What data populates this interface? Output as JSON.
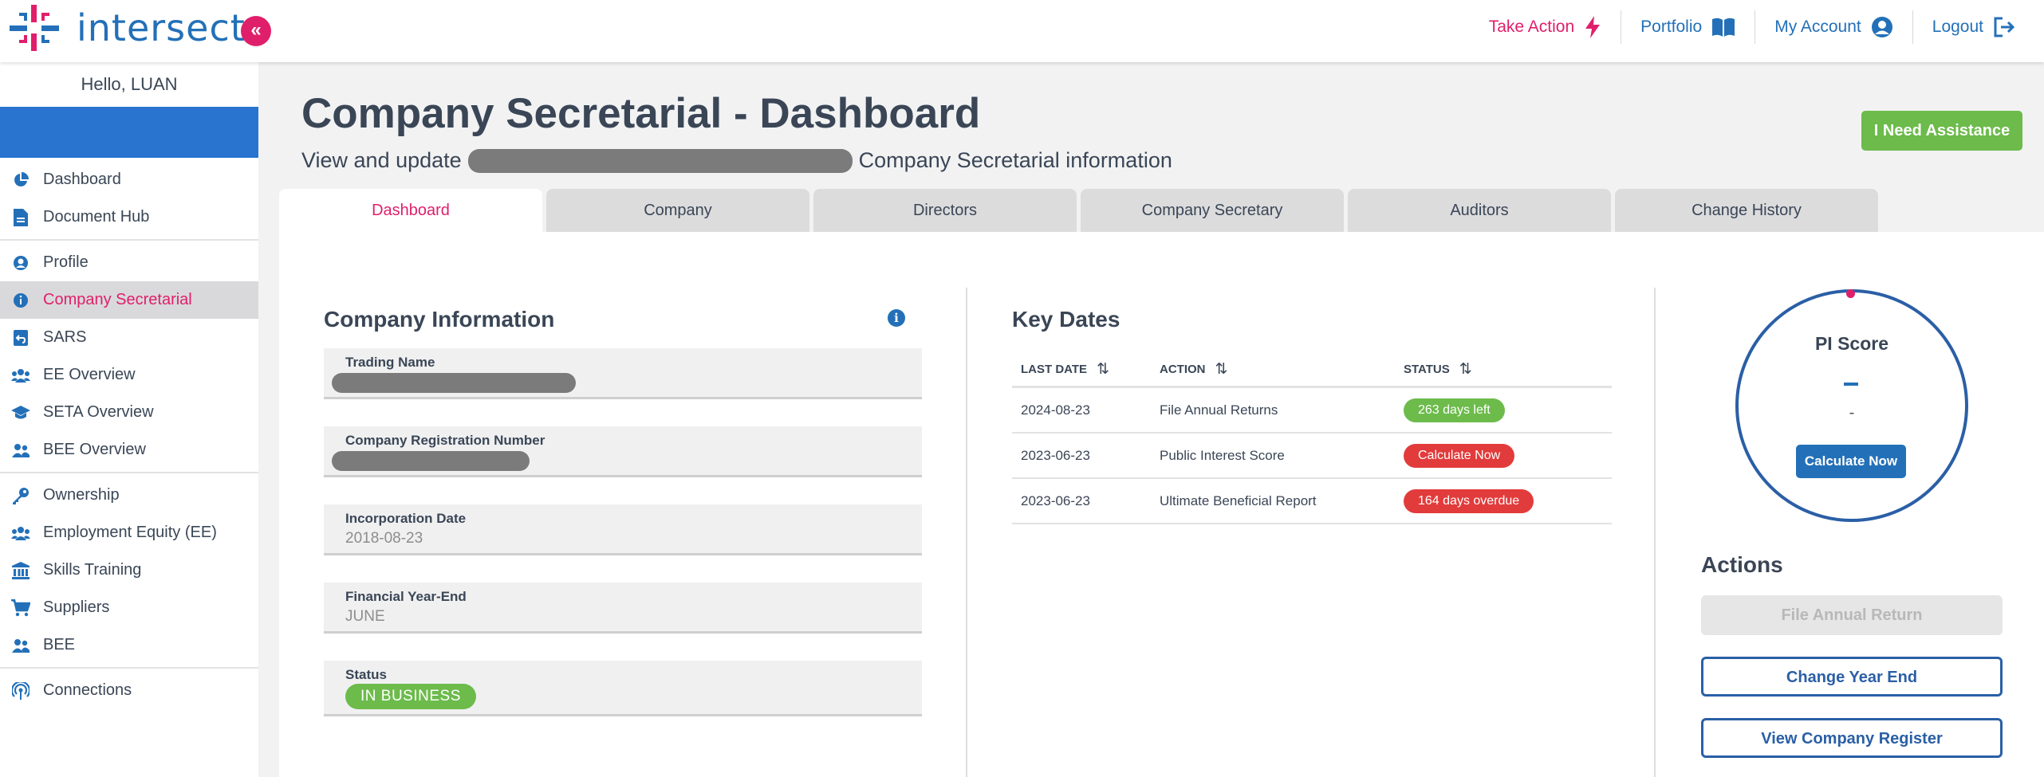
{
  "header": {
    "brand": "intersect",
    "nav": [
      {
        "label": "Take Action",
        "icon": "lightning-icon"
      },
      {
        "label": "Portfolio",
        "icon": "book-icon"
      },
      {
        "label": "My Account",
        "icon": "user-circle-icon"
      },
      {
        "label": "Logout",
        "icon": "logout-icon"
      }
    ]
  },
  "sidebar": {
    "greeting": "Hello, LUAN",
    "groups": [
      [
        {
          "label": "Dashboard",
          "icon": "pie-chart-icon"
        },
        {
          "label": "Document Hub",
          "icon": "document-icon"
        }
      ],
      [
        {
          "label": "Profile",
          "icon": "user-circle-icon"
        },
        {
          "label": "Company Secretarial",
          "icon": "info-icon",
          "active": true
        },
        {
          "label": "SARS",
          "icon": "return-icon"
        },
        {
          "label": "EE Overview",
          "icon": "users-icon"
        },
        {
          "label": "SETA Overview",
          "icon": "graduation-cap-icon"
        },
        {
          "label": "BEE Overview",
          "icon": "people-icon"
        }
      ],
      [
        {
          "label": "Ownership",
          "icon": "key-icon"
        },
        {
          "label": "Employment Equity (EE)",
          "icon": "users-icon"
        },
        {
          "label": "Skills Training",
          "icon": "bank-icon"
        },
        {
          "label": "Suppliers",
          "icon": "cart-icon"
        },
        {
          "label": "BEE",
          "icon": "people-icon"
        }
      ],
      [
        {
          "label": "Connections",
          "icon": "broadcast-icon"
        }
      ]
    ]
  },
  "page": {
    "title": "Company Secretarial - Dashboard",
    "subtitle_before": "View and update",
    "subtitle_after": "Company Secretarial information",
    "assist_label": "I Need Assistance"
  },
  "tabs": [
    "Dashboard",
    "Company",
    "Directors",
    "Company Secretary",
    "Auditors",
    "Change History"
  ],
  "company_info": {
    "title": "Company Information",
    "info_glyph": "i",
    "trading_name_label": "Trading Name",
    "reg_number_label": "Company Registration Number",
    "incorporation_label": "Incorporation Date",
    "incorporation_value": "2018-08-23",
    "fye_label": "Financial Year-End",
    "fye_value": "JUNE",
    "status_label": "Status",
    "status_value": "IN BUSINESS"
  },
  "key_dates": {
    "title": "Key Dates",
    "columns": [
      "LAST DATE",
      "ACTION",
      "STATUS"
    ],
    "sort_glyph": "⇅",
    "rows": [
      {
        "date": "2024-08-23",
        "action": "File Annual Returns",
        "status": "263 days left",
        "color": "#6cbb4b"
      },
      {
        "date": "2023-06-23",
        "action": "Public Interest Score",
        "status": "Calculate Now",
        "color": "#e23b3b"
      },
      {
        "date": "2023-06-23",
        "action": "Ultimate Beneficial Report",
        "status": "164 days overdue",
        "color": "#e23b3b"
      }
    ]
  },
  "pi_score": {
    "title": "PI Score",
    "value": "-",
    "button": "Calculate Now"
  },
  "actions": {
    "title": "Actions",
    "file_annual_return": "File Annual Return",
    "change_year_end": "Change Year End",
    "view_register": "View Company Register"
  }
}
